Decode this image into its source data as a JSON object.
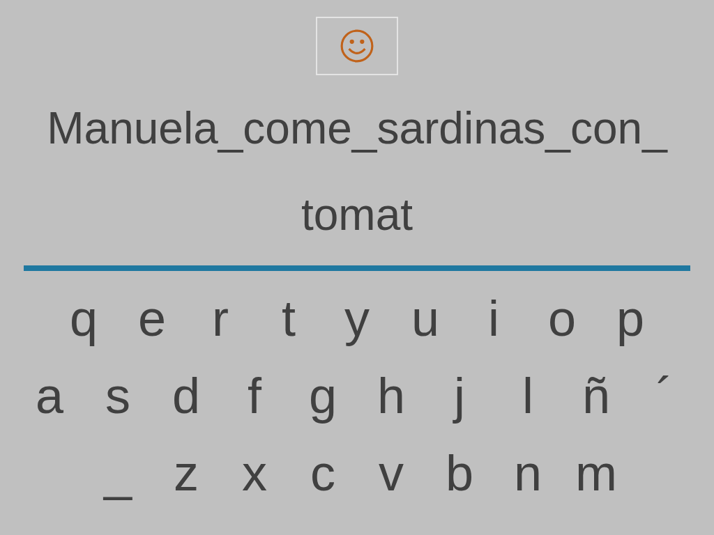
{
  "answer_lines": [
    "Manuela_come_sardinas_con_",
    "tomat"
  ],
  "keyboard": {
    "rows": [
      [
        "q",
        "e",
        "r",
        "t",
        "y",
        "u",
        "i",
        "o",
        "p"
      ],
      [
        "a",
        "s",
        "d",
        "f",
        "g",
        "h",
        "j",
        "l",
        "ñ",
        "´"
      ],
      [
        "_",
        "z",
        "x",
        "c",
        "v",
        "b",
        "n",
        "m"
      ]
    ]
  }
}
